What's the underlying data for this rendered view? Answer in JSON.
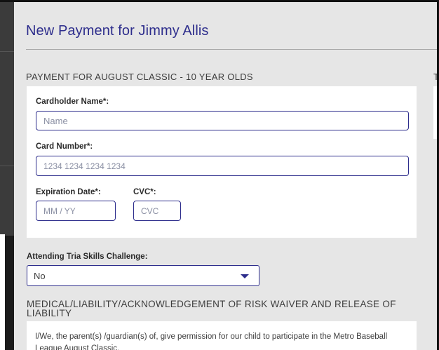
{
  "form": {
    "title": "New Payment for Jimmy Allis",
    "section_heading": "PAYMENT FOR AUGUST CLASSIC - 10 YEAR OLDS",
    "right_column_heading": "T",
    "cardholder": {
      "label": "Cardholder Name*:",
      "placeholder": "Name"
    },
    "card_number": {
      "label": "Card Number*:",
      "placeholder": "1234 1234 1234 1234"
    },
    "expiration": {
      "label": "Expiration Date*:",
      "placeholder": "MM / YY"
    },
    "cvc": {
      "label": "CVC*:",
      "placeholder": "CVC"
    },
    "attending": {
      "label": "Attending Tria Skills Challenge:",
      "selected": "No"
    },
    "waiver": {
      "heading": "MEDICAL/LIABILITY/ACKNOWLEDGEMENT OF RISK WAIVER AND RELEASE OF LIABILITY",
      "text": "I/We, the parent(s) /guardian(s) of, give permission for our child to participate in the Metro Baseball League August Classic."
    }
  },
  "colors": {
    "accent": "#2d2d8c",
    "page_background": "#e6e6e6",
    "card_background": "#ffffff",
    "text": "#3d3d3d"
  },
  "icons": {
    "select_caret": "caret-down-icon"
  }
}
